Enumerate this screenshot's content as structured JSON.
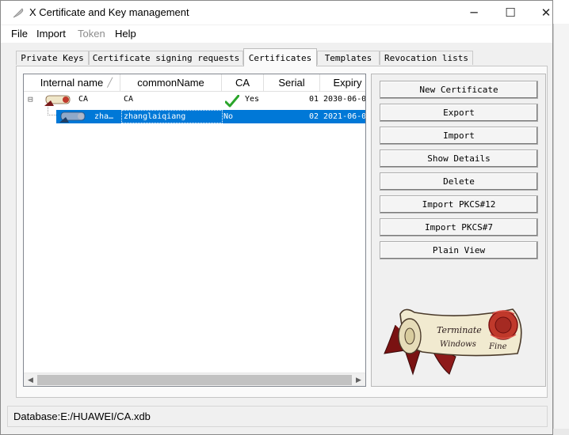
{
  "window": {
    "title": "X Certificate and Key management",
    "minimize_glyph": "─",
    "maximize_glyph": "☐",
    "close_glyph": "✕"
  },
  "menu": [
    {
      "label": "File",
      "disabled": false
    },
    {
      "label": "Import",
      "disabled": false
    },
    {
      "label": "Token",
      "disabled": true
    },
    {
      "label": "Help",
      "disabled": false
    }
  ],
  "tabs": [
    "Private Keys",
    "Certificate signing requests",
    "Certificates",
    "Templates",
    "Revocation lists"
  ],
  "active_tab": "Certificates",
  "table": {
    "columns": [
      "Internal name",
      "commonName",
      "CA",
      "Serial",
      "Expiry"
    ],
    "sort_indicator": "╱",
    "rows": [
      {
        "internal_name": "CA",
        "common_name": "CA",
        "ca": "Yes",
        "serial": "01",
        "expiry": "2030-06-0",
        "expand": "⊟",
        "selected": false
      },
      {
        "internal_name": "zha…",
        "common_name": "zhanglaiqiang",
        "ca": "No",
        "serial": "02",
        "expiry": "2021-06-0",
        "selected": true
      }
    ]
  },
  "buttons": [
    "New Certificate",
    "Export",
    "Import",
    "Show Details",
    "Delete",
    "Import PKCS#12",
    "Import PKCS#7",
    "Plain View"
  ],
  "logo": {
    "line1": "Terminate",
    "line2": "Windows",
    "line3": "Fine"
  },
  "status": {
    "text": "Database:E:/HUAWEI/CA.xdb"
  },
  "scroll": {
    "left": "◀",
    "right": "▶"
  },
  "colors": {
    "selection": "#0078d7",
    "check": "#2aa52a",
    "seal": "#c0392b"
  }
}
